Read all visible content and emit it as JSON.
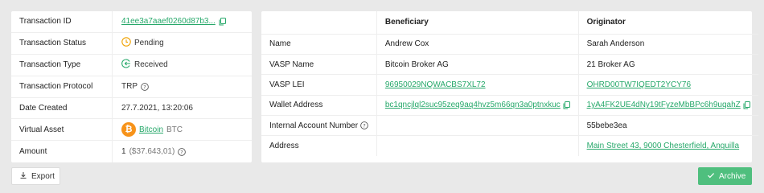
{
  "transaction": {
    "rows": [
      {
        "label": "Transaction ID",
        "value": "41ee3a7aaef0260d87b3..."
      },
      {
        "label": "Transaction Status",
        "value": "Pending"
      },
      {
        "label": "Transaction Type",
        "value": "Received"
      },
      {
        "label": "Transaction Protocol",
        "value": "TRP"
      },
      {
        "label": "Date Created",
        "value": "27.7.2021, 13:20:06"
      },
      {
        "label": "Virtual Asset",
        "value": "Bitcoin",
        "unit": "BTC"
      },
      {
        "label": "Amount",
        "value": "1",
        "secondary": "($37.643,01)"
      }
    ]
  },
  "parties": {
    "headers": [
      "",
      "Beneficiary",
      "Originator"
    ],
    "rows": [
      {
        "label": "Name",
        "beneficiary": "Andrew Cox",
        "originator": "Sarah Anderson"
      },
      {
        "label": "VASP Name",
        "beneficiary": "Bitcoin Broker AG",
        "originator": "21 Broker AG"
      },
      {
        "label": "VASP LEI",
        "beneficiary": "96950029NQWACBS7XL72",
        "originator": "OHRD00TW7IQEDT2YCY76"
      },
      {
        "label": "Wallet Address",
        "beneficiary": "bc1qncjlql2suc95zeq9aq4hvz5m66qn3a0ptnxkuc",
        "originator": "1yA4FK2UE4dNy19tFyzeMbBPc6h9uqahZ"
      },
      {
        "label": "Internal Account Number",
        "beneficiary": "",
        "originator": "55bebe3ea"
      },
      {
        "label": "Address",
        "beneficiary": "",
        "originator": "Main Street 43, 9000 Chesterfield, Anguilla"
      }
    ]
  },
  "actions": {
    "export_label": "Export",
    "archive_label": "Archive"
  },
  "icons": {
    "bitcoin_symbol": "₿"
  },
  "colors": {
    "accent": "#26a86a",
    "pending": "#f0a202",
    "bitcoin": "#f7931a",
    "archive": "#4fbf7e"
  }
}
